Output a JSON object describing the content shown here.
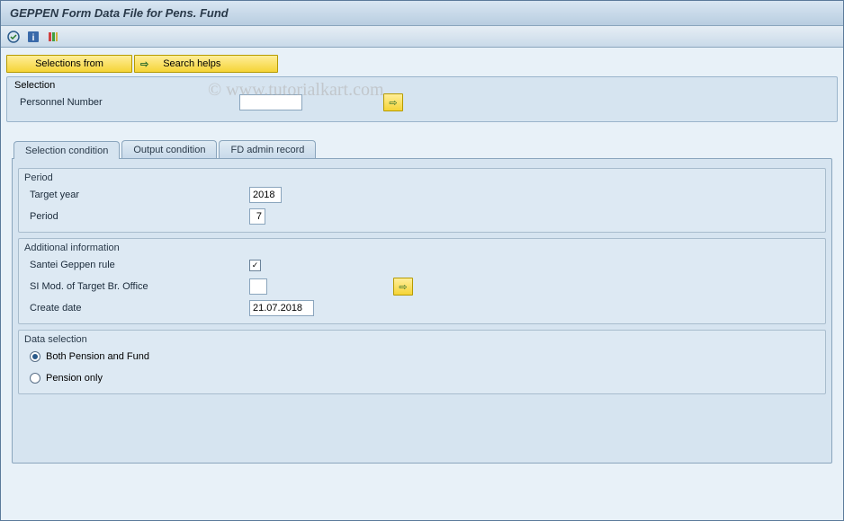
{
  "title": "GEPPEN Form Data File for Pens. Fund",
  "watermark": "© www.tutorialkart.com",
  "toolbar_buttons": {
    "selections_from": "Selections from",
    "search_helps": "Search helps"
  },
  "selection_group": {
    "legend": "Selection",
    "personnel_number_label": "Personnel Number",
    "personnel_number_value": ""
  },
  "tabs": {
    "t1": "Selection condition",
    "t2": "Output condition",
    "t3": "FD admin record"
  },
  "period_group": {
    "legend": "Period",
    "target_year_label": "Target year",
    "target_year_value": "2018",
    "period_label": "Period",
    "period_value": "7"
  },
  "addl_group": {
    "legend": "Additional information",
    "santei_label": "Santei Geppen rule",
    "santei_checked": true,
    "si_mod_label": "SI Mod. of Target Br. Office",
    "si_mod_value": "",
    "create_date_label": "Create date",
    "create_date_value": "21.07.2018"
  },
  "data_sel_group": {
    "legend": "Data selection",
    "opt1": "Both Pension and Fund",
    "opt2": "Pension only",
    "selected": "opt1"
  }
}
